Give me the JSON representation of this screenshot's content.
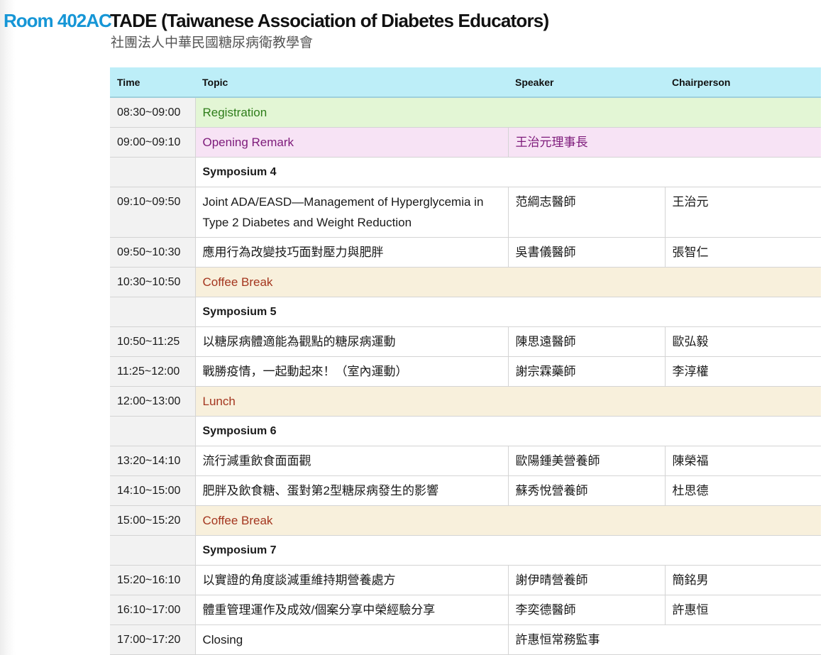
{
  "header": {
    "room": "Room 402AC",
    "title": "TADE (Taiwanese Association of Diabetes Educators)",
    "subtitle": "社團法人中華民國糖尿病衛教學會"
  },
  "table": {
    "columns": [
      "Time",
      "Topic",
      "Speaker",
      "Chairperson"
    ],
    "rows": [
      {
        "type": "registration",
        "time": "08:30~09:00",
        "topic": "Registration",
        "speaker": "",
        "chair": ""
      },
      {
        "type": "opening",
        "time": "09:00~09:10",
        "topic": "Opening Remark",
        "speaker": "王治元理事長",
        "chair": ""
      },
      {
        "type": "symposium",
        "time": "",
        "topic": "Symposium 4",
        "speaker": "",
        "chair": ""
      },
      {
        "type": "talk",
        "time": "09:10~09:50",
        "topic": "Joint ADA/EASD—Management of Hyperglycemia in Type 2 Diabetes and Weight Reduction",
        "speaker": "范綱志醫師",
        "chair": "王治元"
      },
      {
        "type": "talk",
        "time": "09:50~10:30",
        "topic": "應用行為改變技巧面對壓力與肥胖",
        "speaker": "吳書儀醫師",
        "chair": "張智仁"
      },
      {
        "type": "break",
        "time": "10:30~10:50",
        "topic": "Coffee Break",
        "speaker": "",
        "chair": ""
      },
      {
        "type": "symposium",
        "time": "",
        "topic": "Symposium 5",
        "speaker": "",
        "chair": ""
      },
      {
        "type": "talk",
        "time": "10:50~11:25",
        "topic": "以糖尿病體適能為觀點的糖尿病運動",
        "speaker": "陳思遠醫師",
        "chair": "歐弘毅"
      },
      {
        "type": "talk",
        "time": "11:25~12:00",
        "topic": "戰勝疫情，一起動起來！（室內運動）",
        "speaker": "謝宗霖藥師",
        "chair": "李淳權"
      },
      {
        "type": "break",
        "time": "12:00~13:00",
        "topic": "Lunch",
        "speaker": "",
        "chair": ""
      },
      {
        "type": "symposium",
        "time": "",
        "topic": "Symposium 6",
        "speaker": "",
        "chair": ""
      },
      {
        "type": "talk",
        "time": "13:20~14:10",
        "topic": "流行減重飲食面面觀",
        "speaker": "歐陽鍾美營養師",
        "chair": "陳榮福"
      },
      {
        "type": "talk",
        "time": "14:10~15:00",
        "topic": "肥胖及飲食糖、蛋對第2型糖尿病發生的影響",
        "speaker": "蘇秀悅營養師",
        "chair": "杜思德"
      },
      {
        "type": "break",
        "time": "15:00~15:20",
        "topic": "Coffee Break",
        "speaker": "",
        "chair": ""
      },
      {
        "type": "symposium",
        "time": "",
        "topic": "Symposium 7",
        "speaker": "",
        "chair": ""
      },
      {
        "type": "talk",
        "time": "15:20~16:10",
        "topic": "以實證的角度談減重維持期營養處方",
        "speaker": "謝伊晴營養師",
        "chair": "簡銘男"
      },
      {
        "type": "talk",
        "time": "16:10~17:00",
        "topic": "體重管理運作及成效/個案分享中榮經驗分享",
        "speaker": "李奕德醫師",
        "chair": "許惠恒"
      },
      {
        "type": "closing",
        "time": "17:00~17:20",
        "topic": "Closing",
        "speaker": "許惠恒常務監事",
        "chair": ""
      }
    ]
  }
}
